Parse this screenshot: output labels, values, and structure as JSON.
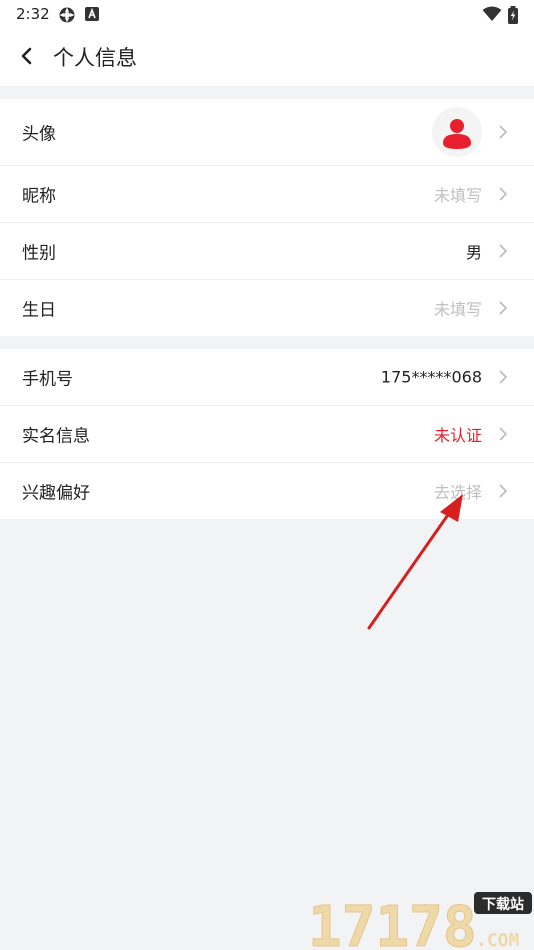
{
  "status_bar": {
    "time": "2:32"
  },
  "header": {
    "title": "个人信息"
  },
  "group1": [
    {
      "label": "头像",
      "type": "avatar"
    },
    {
      "label": "昵称",
      "value": "未填写",
      "style": "placeholder"
    },
    {
      "label": "性别",
      "value": "男",
      "style": "normal"
    },
    {
      "label": "生日",
      "value": "未填写",
      "style": "placeholder"
    }
  ],
  "group2": [
    {
      "label": "手机号",
      "value": "175*****068",
      "style": "normal"
    },
    {
      "label": "实名信息",
      "value": "未认证",
      "style": "alert"
    },
    {
      "label": "兴趣偏好",
      "value": "去选择",
      "style": "placeholder"
    }
  ],
  "colors": {
    "accent": "#e8202d",
    "placeholder": "#c0c0c0",
    "background": "#f2f3f5"
  },
  "watermark": {
    "number": "17178",
    "tag": "下载站",
    "suffix": ".COM"
  }
}
